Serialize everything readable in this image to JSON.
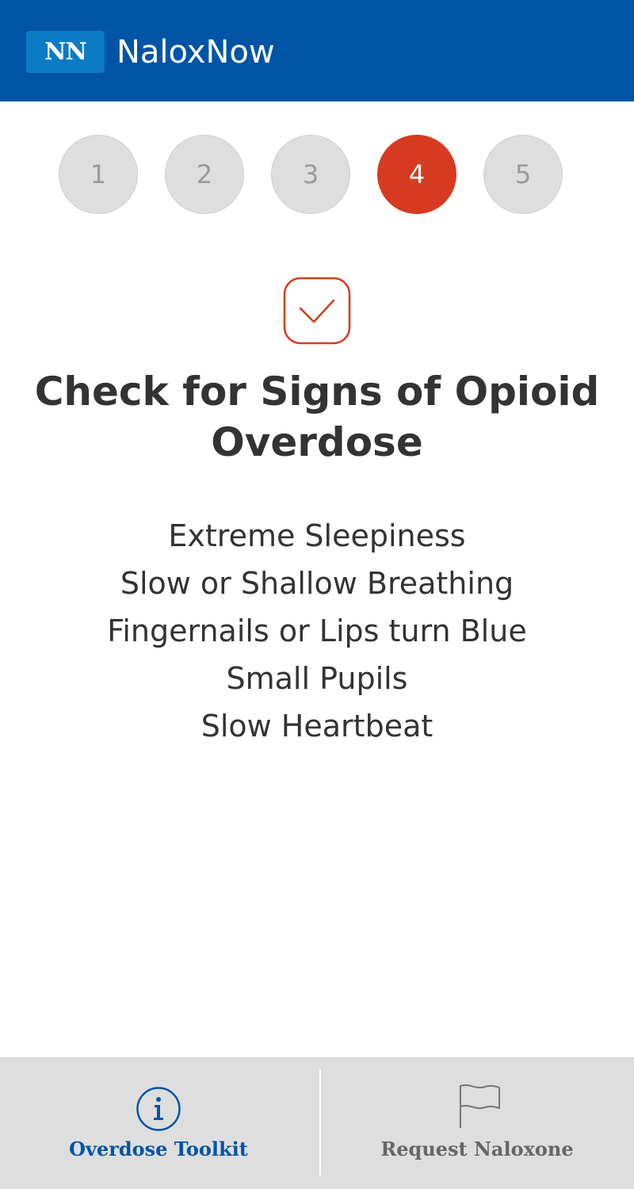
{
  "header": {
    "logo_text": "NN",
    "app_name": "NaloxNow",
    "background_color": "#0054a6"
  },
  "steps": {
    "items": [
      "1",
      "2",
      "3",
      "4",
      "5"
    ],
    "active": "4",
    "active_color": "#d63b1f"
  },
  "content": {
    "icon": "check-icon",
    "title": "Check for Signs of Opioid Overdose",
    "signs": [
      "Extreme Sleepiness",
      "Slow or Shallow Breathing",
      "Fingernails or Lips turn Blue",
      "Small Pupils",
      "Slow Heartbeat"
    ]
  },
  "tabbar": {
    "tabs": [
      {
        "label": "Overdose Toolkit",
        "icon": "info-icon",
        "selected": true
      },
      {
        "label": "Request Naloxone",
        "icon": "flag-icon",
        "selected": false
      }
    ]
  }
}
